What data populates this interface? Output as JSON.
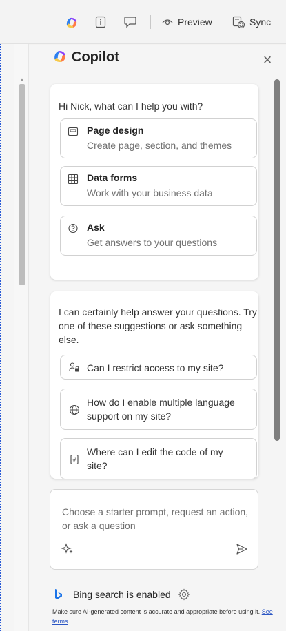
{
  "toolbar": {
    "preview_label": "Preview",
    "sync_label": "Sync"
  },
  "panel": {
    "title": "Copilot",
    "close_glyph": "×",
    "greeting": "Hi Nick, what can I help you with?",
    "options": [
      {
        "title": "Page design",
        "subtitle": "Create page, section, and themes",
        "icon": "page-layout-icon"
      },
      {
        "title": "Data forms",
        "subtitle": "Work with your business data",
        "icon": "table-grid-icon"
      },
      {
        "title": "Ask",
        "subtitle": "Get answers to your questions",
        "icon": "question-bubble-icon"
      }
    ],
    "intro": "I can certainly help answer your questions. Try one of these suggestions or ask something else.",
    "suggestions": [
      {
        "text": "Can I restrict access to my site?",
        "icon": "people-lock-icon"
      },
      {
        "text": "How do I enable multiple language support on my site?",
        "icon": "globe-icon"
      },
      {
        "text": "Where can I edit the code of my site?",
        "icon": "code-file-icon"
      }
    ],
    "input_placeholder": "Choose a starter prompt, request an action, or ask a question",
    "bing_status": "Bing search is enabled",
    "disclaimer_text": "Make sure AI-generated content is accurate and appropriate before using it.",
    "disclaimer_link": "See terms"
  },
  "colors": {
    "link": "#2b56c4",
    "selection_border": "#2a5bd7",
    "bing_blue": "#1a73e8"
  }
}
